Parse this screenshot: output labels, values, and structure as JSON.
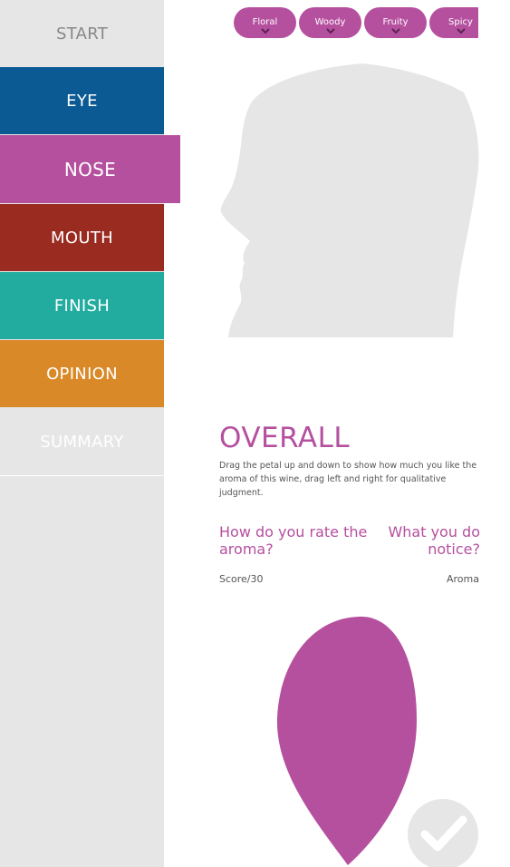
{
  "nav": {
    "start": "START",
    "eye": "EYE",
    "nose": "NOSE",
    "mouth": "MOUTH",
    "finish": "FINISH",
    "opinion": "OPINION",
    "summary": "SUMMARY"
  },
  "aroma_pills": [
    {
      "label": "Floral"
    },
    {
      "label": "Woody"
    },
    {
      "label": "Fruity"
    },
    {
      "label": "Spicy"
    }
  ],
  "section": {
    "title": "OVERALL",
    "description": "Drag the petal up and down to show how much you like the aroma of this wine, drag left and right for qualitative judgment.",
    "question_rate": "How do you rate the aroma?",
    "question_notice": "What you do notice?",
    "score_label": "Score/30",
    "aroma_label": "Aroma"
  },
  "colors": {
    "eye": "#0b5a94",
    "nose": "#b5509f",
    "mouth": "#9a2b21",
    "finish": "#22aca0",
    "opinion": "#d98927",
    "sidebar": "#e6e6e6",
    "head_silhouette": "#e6e6e6"
  },
  "icons": {
    "head": "head-silhouette-icon",
    "petal": "petal-icon",
    "confirm": "checkmark-icon",
    "pill_chevron": "chevron-down-icon"
  }
}
